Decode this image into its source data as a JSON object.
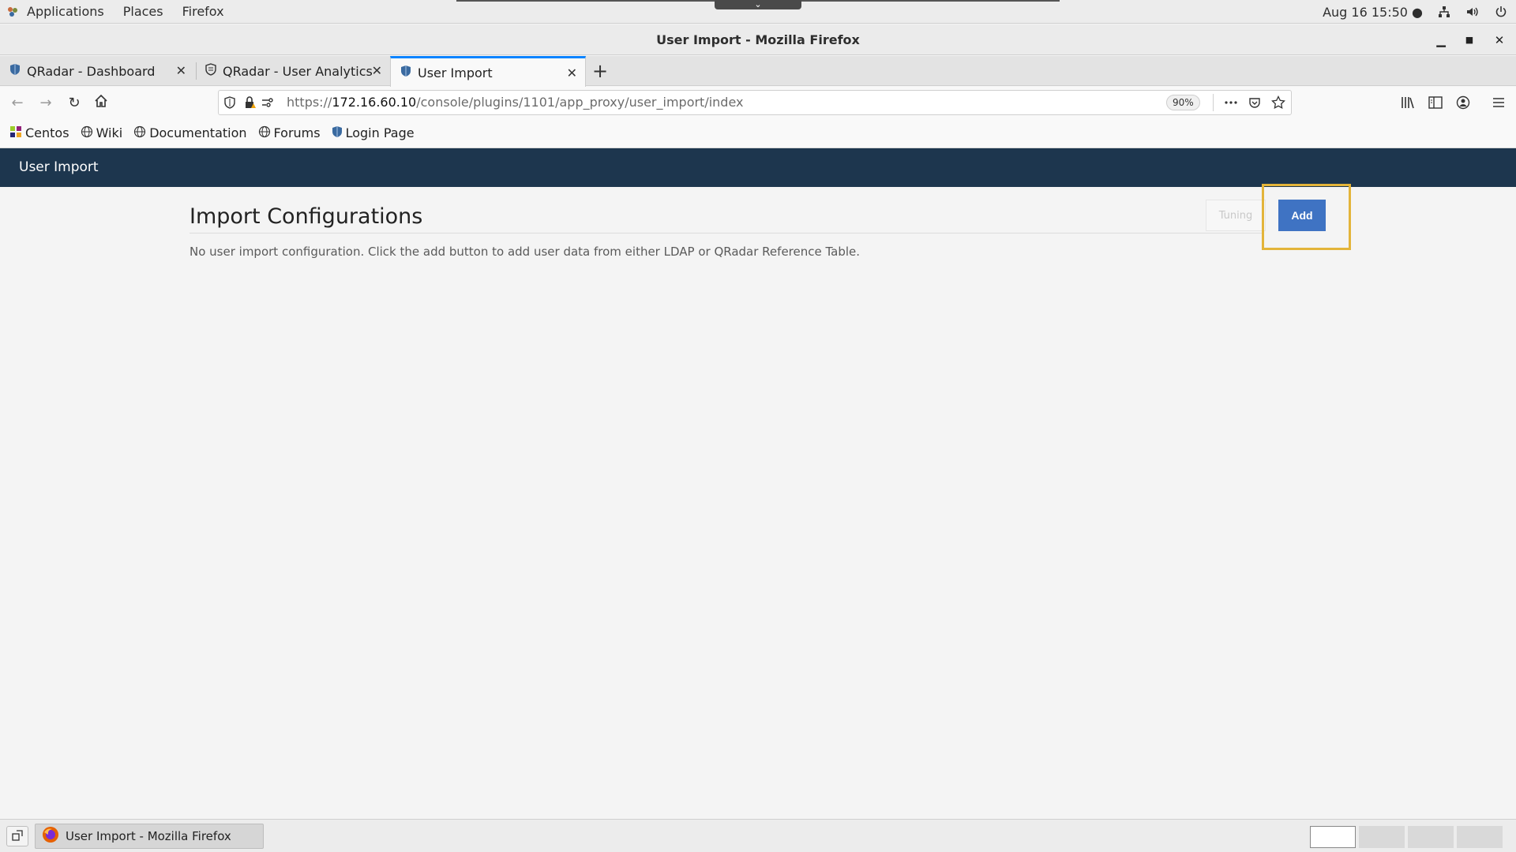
{
  "topbar": {
    "menu": [
      "Applications",
      "Places",
      "Firefox"
    ],
    "clock": "Aug 16  15:50 ●"
  },
  "window": {
    "title": "User Import - Mozilla Firefox"
  },
  "tabs": [
    {
      "label": "QRadar - Dashboard",
      "active": false
    },
    {
      "label": "QRadar - User Analytics",
      "active": false
    },
    {
      "label": "User Import",
      "active": true
    }
  ],
  "navbar": {
    "url_prefix": "https://",
    "url_host": "172.16.60.10",
    "url_path": "/console/plugins/1101/app_proxy/user_import/index",
    "zoom": "90%"
  },
  "bookmarks": [
    "Centos",
    "Wiki",
    "Documentation",
    "Forums",
    "Login Page"
  ],
  "app": {
    "header_title": "User Import",
    "section_title": "Import Configurations",
    "empty_message": "No user import configuration. Click the add button to add user data from either LDAP or QRadar Reference Table.",
    "tuning_label": "Tuning",
    "add_label": "Add",
    "accent_color": "#3f73c3",
    "header_color": "#1d364e",
    "highlight_color": "#e3b43a"
  },
  "taskbar": {
    "task_label": "User Import - Mozilla Firefox"
  }
}
